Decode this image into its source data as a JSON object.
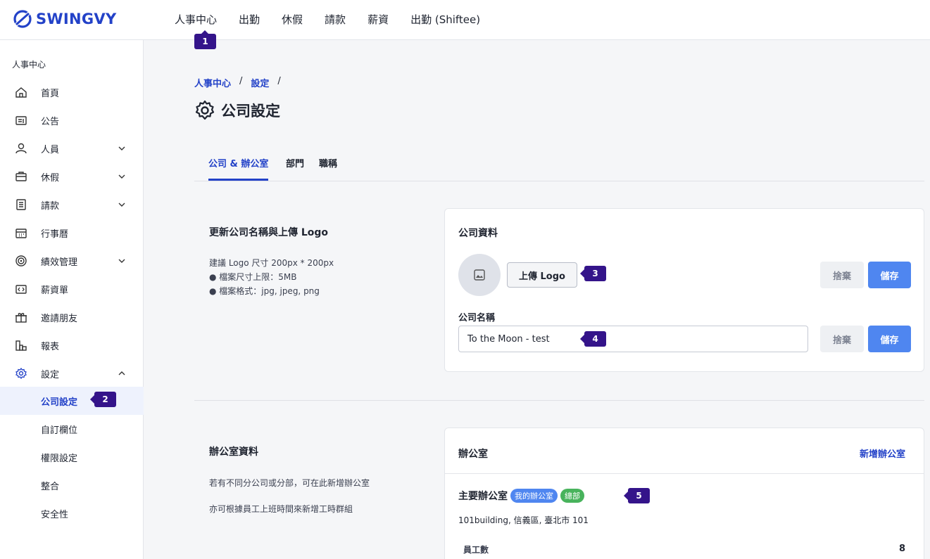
{
  "brand": {
    "name": "SWINGVY"
  },
  "topnav": [
    {
      "label": "人事中心"
    },
    {
      "label": "出勤"
    },
    {
      "label": "休假"
    },
    {
      "label": "請款"
    },
    {
      "label": "薪資"
    },
    {
      "label": "出勤 (Shiftee)"
    }
  ],
  "markers": [
    "1",
    "2",
    "3",
    "4",
    "5"
  ],
  "sidebar": {
    "section": "人事中心",
    "items": [
      {
        "label": "首頁",
        "icon": "home-icon"
      },
      {
        "label": "公告",
        "icon": "announcement-icon"
      },
      {
        "label": "人員",
        "icon": "person-icon"
      },
      {
        "label": "休假",
        "icon": "briefcase-icon"
      },
      {
        "label": "請款",
        "icon": "receipt-icon"
      },
      {
        "label": "行事曆",
        "icon": "calendar-icon"
      },
      {
        "label": "績效管理",
        "icon": "target-icon"
      },
      {
        "label": "薪資單",
        "icon": "payslip-icon"
      },
      {
        "label": "邀請朋友",
        "icon": "gift-icon"
      },
      {
        "label": "報表",
        "icon": "report-icon"
      },
      {
        "label": "設定",
        "icon": "gear-icon"
      }
    ],
    "subitems": [
      {
        "label": "公司設定"
      },
      {
        "label": "自訂欄位"
      },
      {
        "label": "權限設定"
      },
      {
        "label": "整合"
      },
      {
        "label": "安全性"
      }
    ]
  },
  "breadcrumb": {
    "items": [
      "人事中心",
      "設定"
    ],
    "separator": "/"
  },
  "page_title": "公司設定",
  "tabs": [
    {
      "label": "公司 & 辦公室"
    },
    {
      "label": "部門"
    },
    {
      "label": "職稱"
    }
  ],
  "company_section": {
    "title": "更新公司名稱與上傳 Logo",
    "desc": [
      "建議 Logo 尺寸 200px * 200px",
      "● 檔案尺寸上限：5MB",
      "● 檔案格式：jpg, jpeg, png"
    ]
  },
  "company_card": {
    "title": "公司資料",
    "upload_label": "上傳 Logo",
    "discard_label": "捨棄",
    "save_label": "儲存",
    "name_label": "公司名稱",
    "name_value": "To the Moon - test"
  },
  "office_section": {
    "title": "辦公室資料",
    "desc1": "若有不同分公司或分部，可在此新增辦公室",
    "desc2": "亦可根據員工上班時間來新增工時群組"
  },
  "office_card": {
    "title": "辦公室",
    "add_label": "新增辦公室",
    "office_name": "主要辦公室",
    "badge_mine": "我的辦公室",
    "badge_hq": "總部",
    "address": "101building, 信義區, 臺北市 101",
    "employee_label": "員工數",
    "employee_count": "8"
  },
  "colors": {
    "brand": "#2342c8",
    "primary": "#4f86f0",
    "marker": "#34148a",
    "badge_green": "#48b35c"
  }
}
